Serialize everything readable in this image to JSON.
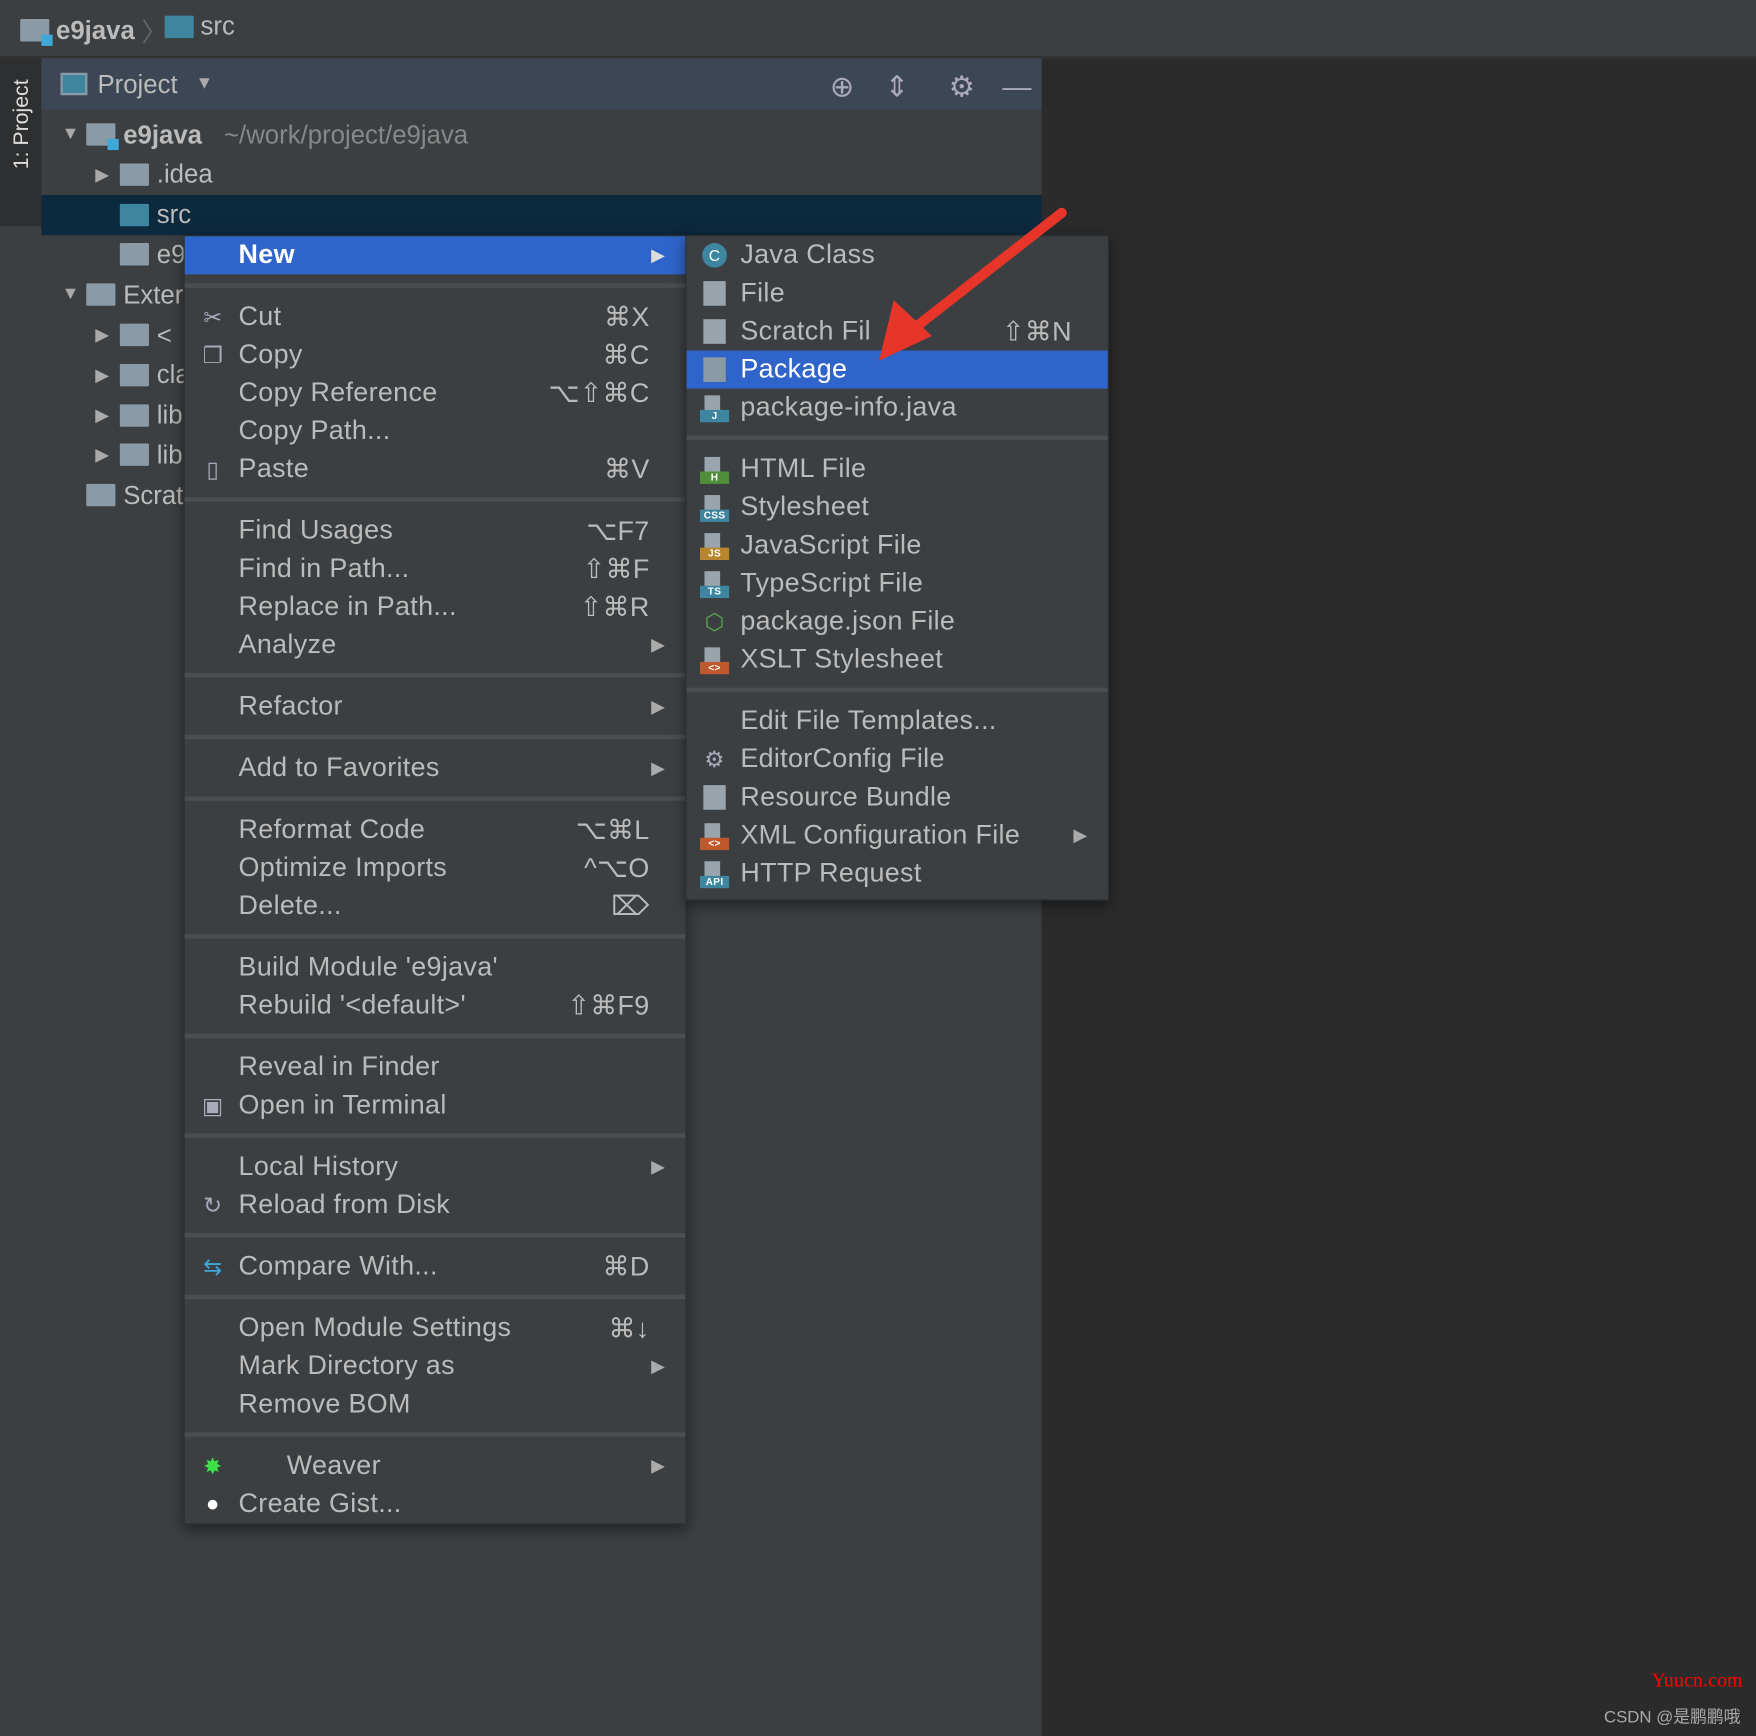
{
  "breadcrumb": [
    "e9java",
    "src"
  ],
  "tool_window": {
    "stripe_label": "1: Project",
    "title": "Project"
  },
  "tree": [
    {
      "label": "e9java",
      "path": "~/work/project/e9java",
      "expanded": true
    },
    {
      "label": ".idea",
      "expanded": false
    },
    {
      "label": "src",
      "selected": true
    },
    {
      "label": "e9"
    },
    {
      "label": "Exter",
      "expanded": true
    },
    {
      "label": "<",
      "expanded": false
    },
    {
      "label": "cla",
      "expanded": false
    },
    {
      "label": "lib",
      "expanded": false
    },
    {
      "label": "lib",
      "expanded": false
    },
    {
      "label": "Scrat"
    }
  ],
  "context_menu": [
    {
      "label": "New",
      "submenu": true,
      "highlighted": true
    },
    {
      "sep": true
    },
    {
      "label": "Cut",
      "shortcut": "⌘X",
      "icon": "scissors-icon"
    },
    {
      "label": "Copy",
      "shortcut": "⌘C",
      "icon": "copy-icon"
    },
    {
      "label": "Copy Reference",
      "shortcut": "⌥⇧⌘C"
    },
    {
      "label": "Copy Path..."
    },
    {
      "label": "Paste",
      "shortcut": "⌘V",
      "icon": "clipboard-icon"
    },
    {
      "sep": true
    },
    {
      "label": "Find Usages",
      "shortcut": "⌥F7"
    },
    {
      "label": "Find in Path...",
      "shortcut": "⇧⌘F"
    },
    {
      "label": "Replace in Path...",
      "shortcut": "⇧⌘R"
    },
    {
      "label": "Analyze",
      "submenu": true
    },
    {
      "sep": true
    },
    {
      "label": "Refactor",
      "submenu": true
    },
    {
      "sep": true
    },
    {
      "label": "Add to Favorites",
      "submenu": true
    },
    {
      "sep": true
    },
    {
      "label": "Reformat Code",
      "shortcut": "⌥⌘L"
    },
    {
      "label": "Optimize Imports",
      "shortcut": "^⌥O"
    },
    {
      "label": "Delete...",
      "shortcut": "⌦"
    },
    {
      "sep": true
    },
    {
      "label": "Build Module 'e9java'"
    },
    {
      "label": "Rebuild '<default>'",
      "shortcut": "⇧⌘F9"
    },
    {
      "sep": true
    },
    {
      "label": "Reveal in Finder"
    },
    {
      "label": "Open in Terminal",
      "icon": "terminal-icon"
    },
    {
      "sep": true
    },
    {
      "label": "Local History",
      "submenu": true
    },
    {
      "label": "Reload from Disk",
      "icon": "reload-icon"
    },
    {
      "sep": true
    },
    {
      "label": "Compare With...",
      "shortcut": "⌘D",
      "icon": "compare-icon"
    },
    {
      "sep": true
    },
    {
      "label": "Open Module Settings",
      "shortcut": "⌘↓"
    },
    {
      "label": "Mark Directory as",
      "submenu": true
    },
    {
      "label": "Remove BOM"
    },
    {
      "sep": true
    },
    {
      "label": "Weaver",
      "submenu": true,
      "icon": "weaver-icon"
    },
    {
      "label": "Create Gist...",
      "icon": "github-icon"
    }
  ],
  "new_submenu": [
    {
      "label": "Java Class",
      "icon": "java-class-icon"
    },
    {
      "label": "File",
      "icon": "file-icon"
    },
    {
      "label": "Scratch Fil",
      "shortcut": "⇧⌘N",
      "icon": "scratch-file-icon"
    },
    {
      "label": "Package",
      "highlighted": true,
      "icon": "package-icon"
    },
    {
      "label": "package-info.java",
      "icon": "java-file-icon",
      "badge": "J"
    },
    {
      "sep": true
    },
    {
      "label": "HTML File",
      "icon": "html-file-icon",
      "badge": "H"
    },
    {
      "label": "Stylesheet",
      "icon": "css-file-icon",
      "badge": "CSS"
    },
    {
      "label": "JavaScript File",
      "icon": "js-file-icon",
      "badge": "JS"
    },
    {
      "label": "TypeScript File",
      "icon": "ts-file-icon",
      "badge": "TS"
    },
    {
      "label": "package.json File",
      "icon": "nodejs-icon"
    },
    {
      "label": "XSLT Stylesheet",
      "icon": "xslt-file-icon",
      "badge": "<>"
    },
    {
      "sep": true
    },
    {
      "label": "Edit File Templates..."
    },
    {
      "label": "EditorConfig File",
      "icon": "gear-icon"
    },
    {
      "label": "Resource Bundle",
      "icon": "resource-bundle-icon"
    },
    {
      "label": "XML Configuration File",
      "submenu": true,
      "icon": "xml-file-icon",
      "badge": "<>"
    },
    {
      "label": "HTTP Request",
      "icon": "api-file-icon",
      "badge": "API"
    }
  ],
  "watermarks": [
    "Yuucn.com",
    "CSDN @是鹏鹏哦"
  ],
  "colors": {
    "highlight": "#2f65ca",
    "selection": "#0d293e",
    "arrow": "#e8352a"
  }
}
